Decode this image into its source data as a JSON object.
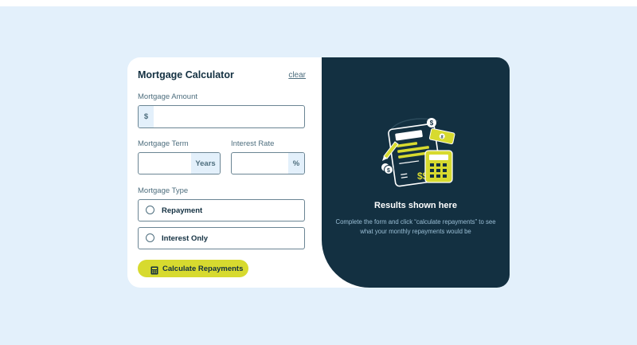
{
  "form": {
    "title": "Mortgage Calculator",
    "clear_label": "clear",
    "amount": {
      "label": "Mortgage Amount",
      "prefix": "$",
      "value": "",
      "placeholder": ""
    },
    "term": {
      "label": "Mortgage Term",
      "suffix": "Years",
      "value": "",
      "placeholder": ""
    },
    "rate": {
      "label": "Interest Rate",
      "suffix": "%",
      "value": "",
      "placeholder": ""
    },
    "type": {
      "label": "Mortgage Type",
      "options": [
        {
          "label": "Repayment",
          "selected": false
        },
        {
          "label": "Interest Only",
          "selected": false
        }
      ]
    },
    "calculate_label": "Calculate Repayments"
  },
  "results": {
    "title": "Results shown here",
    "description": "Complete the form and click “calculate repayments” to see what your monthly repayments would be"
  },
  "colors": {
    "page_bg": "#e3f0fb",
    "panel_dark": "#133041",
    "accent_lime": "#d7da2f",
    "text_dark": "#133041",
    "text_slate": "#4e6e7e",
    "text_muted_light": "#9abed5"
  },
  "icons": {
    "calculate_button": "calculator-icon",
    "illustration": "mortgage-document-illustration"
  }
}
